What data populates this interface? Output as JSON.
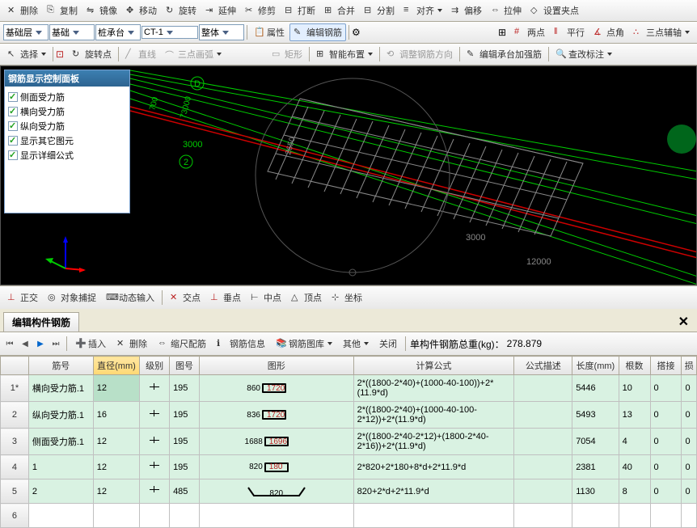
{
  "toolbar1": {
    "delete": "删除",
    "copy": "复制",
    "mirror": "镜像",
    "move": "移动",
    "rotate": "旋转",
    "extend": "延伸",
    "trim": "修剪",
    "break": "打断",
    "merge": "合并",
    "split": "分割",
    "align": "对齐",
    "offset": "偏移",
    "stretch": "拉伸",
    "setgrip": "设置夹点"
  },
  "toolbar2": {
    "layer1": "基础层",
    "layer2": "基础",
    "layer3": "桩承台",
    "item": "CT-1",
    "mode": "整体",
    "props": "属性",
    "editbar": "编辑钢筋",
    "twopt": "两点",
    "parallel": "平行",
    "ptang": "点角",
    "threetpt": "三点辅轴"
  },
  "toolbar3": {
    "select": "选择",
    "rotpt": "旋转点",
    "line": "直线",
    "arc3": "三点画弧",
    "rect": "矩形",
    "smart": "智能布置",
    "adjust": "调整钢筋方向",
    "editcap": "编辑承台加强筋",
    "check": "查改标注"
  },
  "panel": {
    "title": "钢筋显示控制面板",
    "c1": "侧面受力筋",
    "c2": "横向受力筋",
    "c3": "纵向受力筋",
    "c4": "显示其它图元",
    "c5": "显示详细公式"
  },
  "dims": {
    "d1": "D",
    "d2": "2",
    "d3": "3000",
    "d4": "2650",
    "d5": "3000",
    "d6": "12000",
    "d7": "73000",
    "d8": "700"
  },
  "statusbar": {
    "ortho": "正交",
    "osnap": "对象捕捉",
    "dyn": "动态输入",
    "inter": "交点",
    "perp": "垂点",
    "mid": "中点",
    "apex": "顶点",
    "coord": "坐标"
  },
  "tab": {
    "title": "编辑构件钢筋"
  },
  "bottombar": {
    "insert": "插入",
    "delete": "删除",
    "scale": "缩尺配筋",
    "info": "钢筋信息",
    "lib": "钢筋图库",
    "other": "其他",
    "close": "关闭",
    "weightlbl": "单构件钢筋总重(kg)：",
    "weight": "278.879"
  },
  "columns": {
    "c0": "",
    "c1": "筋号",
    "c2": "直径(mm)",
    "c3": "级别",
    "c4": "图号",
    "c5": "图形",
    "c6": "计算公式",
    "c7": "公式描述",
    "c8": "长度(mm)",
    "c9": "根数",
    "c10": "搭接",
    "c11": "损"
  },
  "rows": [
    {
      "n": "1*",
      "name": "横向受力筋.1",
      "dia": "12",
      "grade": "Φ",
      "code": "195",
      "sn": "860",
      "sr": "1720",
      "formula": "2*((1800-2*40)+(1000-40-100))+2*(11.9*d)",
      "desc": "",
      "len": "5446",
      "cnt": "10",
      "lap": "0",
      "loss": "0"
    },
    {
      "n": "2",
      "name": "纵向受力筋.1",
      "dia": "16",
      "grade": "Φ",
      "code": "195",
      "sn": "836",
      "sr": "1720",
      "formula": "2*((1800-2*40)+(1000-40-100-2*12))+2*(11.9*d)",
      "desc": "",
      "len": "5493",
      "cnt": "13",
      "lap": "0",
      "loss": "0"
    },
    {
      "n": "3",
      "name": "侧面受力筋.1",
      "dia": "12",
      "grade": "Φ",
      "code": "195",
      "sn": "1688",
      "sr": "1696",
      "formula": "2*((1800-2*40-2*12)+(1800-2*40-2*16))+2*(11.9*d)",
      "desc": "",
      "len": "7054",
      "cnt": "4",
      "lap": "0",
      "loss": "0"
    },
    {
      "n": "4",
      "name": "1",
      "dia": "12",
      "grade": "Φ",
      "code": "195",
      "sn": "820",
      "sr": "180",
      "formula": "2*820+2*180+8*d+2*11.9*d",
      "desc": "",
      "len": "2381",
      "cnt": "40",
      "lap": "0",
      "loss": "0"
    },
    {
      "n": "5",
      "name": "2",
      "dia": "12",
      "grade": "Φ",
      "code": "485",
      "sn": "",
      "sr": "820",
      "formula": "820+2*d+2*11.9*d",
      "desc": "",
      "len": "1130",
      "cnt": "8",
      "lap": "0",
      "loss": "0"
    }
  ],
  "row6": "6"
}
